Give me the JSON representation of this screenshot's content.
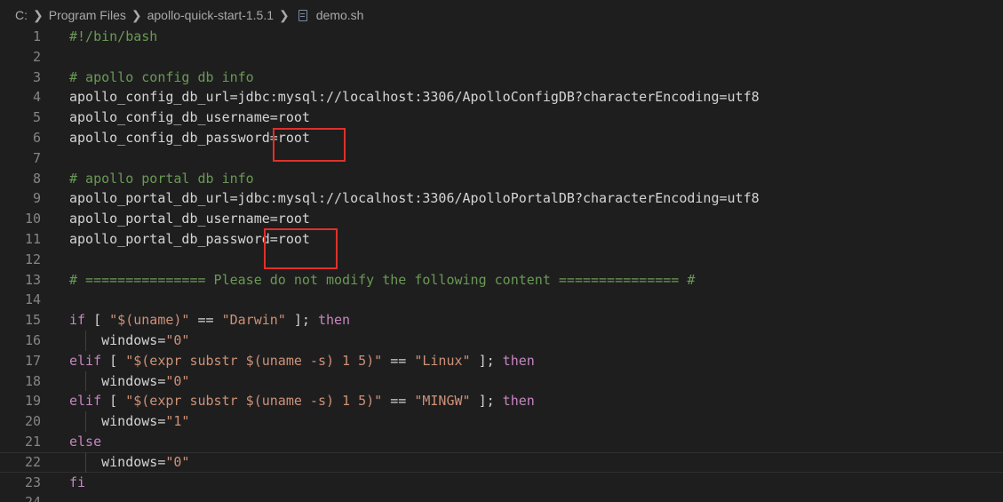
{
  "breadcrumb": {
    "items": [
      "C:",
      "Program Files",
      "apollo-quick-start-1.5.1"
    ],
    "file": "demo.sh"
  },
  "editor": {
    "lines": [
      {
        "n": "1",
        "text": "#!/bin/bash",
        "kind": "comment"
      },
      {
        "n": "2",
        "text": "",
        "kind": "plain"
      },
      {
        "n": "3",
        "text": "# apollo config db info",
        "kind": "comment"
      },
      {
        "n": "4",
        "text": "apollo_config_db_url=jdbc:mysql://localhost:3306/ApolloConfigDB?characterEncoding=utf8",
        "kind": "plain"
      },
      {
        "n": "5",
        "text": "apollo_config_db_username=root",
        "kind": "plain"
      },
      {
        "n": "6",
        "text": "apollo_config_db_password=root",
        "kind": "plain"
      },
      {
        "n": "7",
        "text": "",
        "kind": "plain"
      },
      {
        "n": "8",
        "text": "# apollo portal db info",
        "kind": "comment"
      },
      {
        "n": "9",
        "text": "apollo_portal_db_url=jdbc:mysql://localhost:3306/ApolloPortalDB?characterEncoding=utf8",
        "kind": "plain"
      },
      {
        "n": "10",
        "text": "apollo_portal_db_username=root",
        "kind": "plain"
      },
      {
        "n": "11",
        "text": "apollo_portal_db_password=root",
        "kind": "plain"
      },
      {
        "n": "12",
        "text": "",
        "kind": "plain"
      },
      {
        "n": "13",
        "text": "# =============== Please do not modify the following content =============== #",
        "kind": "comment"
      },
      {
        "n": "14",
        "text": "",
        "kind": "plain"
      },
      {
        "n": "15",
        "kind": "tokens",
        "tokens": [
          {
            "t": "if",
            "c": "keyword"
          },
          {
            "t": " [ ",
            "c": "plain"
          },
          {
            "t": "\"$(uname)\"",
            "c": "string"
          },
          {
            "t": " == ",
            "c": "plain"
          },
          {
            "t": "\"Darwin\"",
            "c": "string"
          },
          {
            "t": " ]; ",
            "c": "plain"
          },
          {
            "t": "then",
            "c": "keyword"
          }
        ]
      },
      {
        "n": "16",
        "kind": "tokens",
        "indent": true,
        "tokens": [
          {
            "t": "    windows=",
            "c": "plain"
          },
          {
            "t": "\"0\"",
            "c": "string"
          }
        ]
      },
      {
        "n": "17",
        "kind": "tokens",
        "tokens": [
          {
            "t": "elif",
            "c": "keyword"
          },
          {
            "t": " [ ",
            "c": "plain"
          },
          {
            "t": "\"$(expr substr $(uname -s) 1 5)\"",
            "c": "string"
          },
          {
            "t": " == ",
            "c": "plain"
          },
          {
            "t": "\"Linux\"",
            "c": "string"
          },
          {
            "t": " ]; ",
            "c": "plain"
          },
          {
            "t": "then",
            "c": "keyword"
          }
        ]
      },
      {
        "n": "18",
        "kind": "tokens",
        "indent": true,
        "tokens": [
          {
            "t": "    windows=",
            "c": "plain"
          },
          {
            "t": "\"0\"",
            "c": "string"
          }
        ]
      },
      {
        "n": "19",
        "kind": "tokens",
        "tokens": [
          {
            "t": "elif",
            "c": "keyword"
          },
          {
            "t": " [ ",
            "c": "plain"
          },
          {
            "t": "\"$(expr substr $(uname -s) 1 5)\"",
            "c": "string"
          },
          {
            "t": " == ",
            "c": "plain"
          },
          {
            "t": "\"MINGW\"",
            "c": "string"
          },
          {
            "t": " ]; ",
            "c": "plain"
          },
          {
            "t": "then",
            "c": "keyword"
          }
        ]
      },
      {
        "n": "20",
        "kind": "tokens",
        "indent": true,
        "tokens": [
          {
            "t": "    windows=",
            "c": "plain"
          },
          {
            "t": "\"1\"",
            "c": "string"
          }
        ]
      },
      {
        "n": "21",
        "kind": "tokens",
        "tokens": [
          {
            "t": "else",
            "c": "keyword"
          }
        ]
      },
      {
        "n": "22",
        "kind": "tokens",
        "indent": true,
        "current": true,
        "tokens": [
          {
            "t": "    windows=",
            "c": "plain"
          },
          {
            "t": "\"0\"",
            "c": "string"
          }
        ]
      },
      {
        "n": "23",
        "kind": "tokens",
        "tokens": [
          {
            "t": "fi",
            "c": "keyword"
          }
        ]
      },
      {
        "n": "24",
        "text": "",
        "kind": "plain"
      }
    ]
  },
  "colors": {
    "background": "#1e1e1e",
    "line_number": "#858585",
    "text": "#d4d4d4",
    "comment": "#6a9955",
    "keyword": "#c586c0",
    "string": "#ce9178",
    "annotation_box": "#e0302a"
  },
  "icons": {
    "breadcrumb_separator": "chevron-right-icon",
    "file": "shell-file-icon"
  }
}
